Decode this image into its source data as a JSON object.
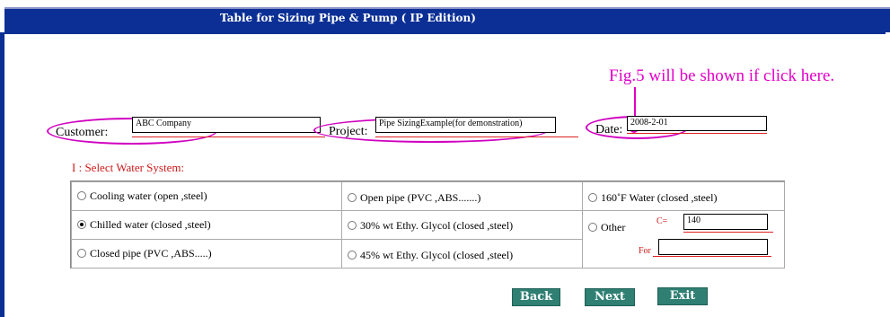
{
  "window": {
    "title": "Table for Sizing Pipe & Pump ( IP  Edition)"
  },
  "annotation": {
    "text": "Fig.5 will be shown if click here."
  },
  "form": {
    "customer_label": "Customer:",
    "customer_value": "ABC Company",
    "project_label": "Project:",
    "project_value": "Pipe SizingExample(for demonstration)",
    "date_label": "Date:",
    "date_value": "2008-2-01"
  },
  "section": {
    "title": "I : Select Water System:"
  },
  "options": {
    "r1c1": "Cooling water (open ,steel)",
    "r2c1": "Chilled water (closed ,steel)",
    "r3c1": "Closed pipe (PVC ,ABS.....)",
    "r1c2": "Open pipe (PVC ,ABS.......)",
    "r2c2": "30% wt Ethy. Glycol (closed ,steel)",
    "r3c2": "45% wt Ethy. Glycol (closed ,steel)",
    "r1c3": "160˚F  Water (closed ,steel)",
    "other": "Other",
    "c_label": "C=",
    "c_value": "140",
    "for_label": "For",
    "for_value": "",
    "selected": "r2c1"
  },
  "buttons": {
    "back": "Back",
    "next": "Next",
    "exit": "Exit"
  }
}
